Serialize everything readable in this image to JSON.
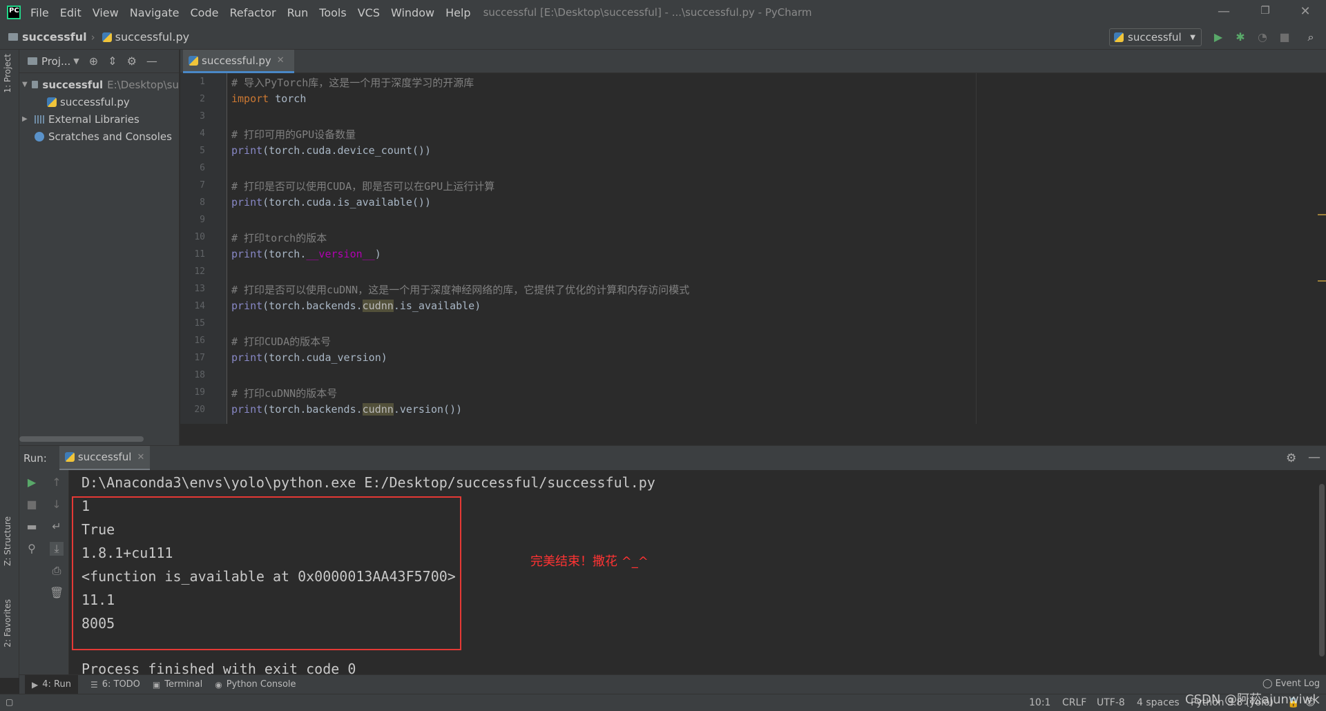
{
  "window": {
    "title": "successful [E:\\Desktop\\successful] - ...\\successful.py - PyCharm",
    "menu": [
      "File",
      "Edit",
      "View",
      "Navigate",
      "Code",
      "Refactor",
      "Run",
      "Tools",
      "VCS",
      "Window",
      "Help"
    ],
    "logo": "PC"
  },
  "navbar": {
    "project": "successful",
    "file": "successful.py",
    "run_config": "successful"
  },
  "left_stripe": {
    "project_tab": "1: Project",
    "structure_tab": "Z: Structure",
    "favorites_tab": "2: Favorites"
  },
  "project_panel": {
    "title": "Proj...",
    "tree": {
      "root_label": "successful",
      "root_path": "E:\\Desktop\\su",
      "file": "successful.py",
      "external_libraries": "External Libraries",
      "scratches": "Scratches and Consoles"
    }
  },
  "editor": {
    "tab_label": "successful.py",
    "lines": [
      {
        "n": "1",
        "parts": [
          {
            "t": "# 导入PyTorch库，这是一个用于深度学习的开源库",
            "c": "comment"
          }
        ]
      },
      {
        "n": "2",
        "parts": [
          {
            "t": "import",
            "c": "kw"
          },
          {
            "t": " torch",
            "c": "plain"
          }
        ]
      },
      {
        "n": "3",
        "parts": []
      },
      {
        "n": "4",
        "parts": [
          {
            "t": "# 打印可用的GPU设备数量",
            "c": "comment"
          }
        ]
      },
      {
        "n": "5",
        "parts": [
          {
            "t": "print",
            "c": "fn"
          },
          {
            "t": "(torch.cuda.device_count())",
            "c": "plain"
          }
        ]
      },
      {
        "n": "6",
        "parts": []
      },
      {
        "n": "7",
        "parts": [
          {
            "t": "# 打印是否可以使用CUDA，即是否可以在GPU上运行计算",
            "c": "comment"
          }
        ]
      },
      {
        "n": "8",
        "parts": [
          {
            "t": "print",
            "c": "fn"
          },
          {
            "t": "(torch.cuda.is_available())",
            "c": "plain"
          }
        ]
      },
      {
        "n": "9",
        "parts": []
      },
      {
        "n": "10",
        "parts": [
          {
            "t": "# 打印torch的版本",
            "c": "comment"
          }
        ]
      },
      {
        "n": "11",
        "parts": [
          {
            "t": "print",
            "c": "fn"
          },
          {
            "t": "(torch.",
            "c": "plain"
          },
          {
            "t": "__version__",
            "c": "magic"
          },
          {
            "t": ")",
            "c": "plain"
          }
        ]
      },
      {
        "n": "12",
        "parts": []
      },
      {
        "n": "13",
        "parts": [
          {
            "t": "# 打印是否可以使用cuDNN，这是一个用于深度神经网络的库，它提供了优化的计算和内存访问模式",
            "c": "comment"
          }
        ]
      },
      {
        "n": "14",
        "parts": [
          {
            "t": "print",
            "c": "fn"
          },
          {
            "t": "(torch.backends.",
            "c": "plain"
          },
          {
            "t": "cudnn",
            "c": "hl"
          },
          {
            "t": ".is_available)",
            "c": "plain"
          }
        ]
      },
      {
        "n": "15",
        "parts": []
      },
      {
        "n": "16",
        "parts": [
          {
            "t": "# 打印CUDA的版本号",
            "c": "comment"
          }
        ]
      },
      {
        "n": "17",
        "parts": [
          {
            "t": "print",
            "c": "fn"
          },
          {
            "t": "(torch.cuda_version)",
            "c": "plain"
          }
        ]
      },
      {
        "n": "18",
        "parts": []
      },
      {
        "n": "19",
        "parts": [
          {
            "t": "# 打印cuDNN的版本号",
            "c": "comment"
          }
        ]
      },
      {
        "n": "20",
        "parts": [
          {
            "t": "print",
            "c": "fn"
          },
          {
            "t": "(torch.backends.",
            "c": "plain"
          },
          {
            "t": "cudnn",
            "c": "hl"
          },
          {
            "t": ".version())",
            "c": "plain"
          }
        ]
      }
    ]
  },
  "run_panel": {
    "label": "Run:",
    "tab_label": "successful",
    "command": "D:\\Anaconda3\\envs\\yolo\\python.exe E:/Desktop/successful/successful.py",
    "output": [
      "1",
      "True",
      "1.8.1+cu111",
      "<function is_available at 0x0000013AA43F5700>",
      "11.1",
      "8005"
    ],
    "finish": "Process finished with exit code 0",
    "annotation": "完美结束！撒花 ^_^"
  },
  "bottom_tabs": {
    "run": "4: Run",
    "todo": "6: TODO",
    "terminal": "Terminal",
    "python_console": "Python Console",
    "event_log": "Event Log"
  },
  "statusbar": {
    "position": "10:1",
    "line_sep": "CRLF",
    "encoding": "UTF-8",
    "indent": "4 spaces",
    "interpreter": "Python 3.8 (yolo)"
  },
  "watermark": "CSDN @阿菘ajunwiwk",
  "colors": {
    "comment": "#808080",
    "keyword": "#cc7832",
    "builtin": "#8888c6",
    "plain": "#a9b7c6",
    "magic": "#b200b2",
    "highlight_bg": "#52503a",
    "annotation": "#ff3333",
    "run_green": "#59a869"
  }
}
